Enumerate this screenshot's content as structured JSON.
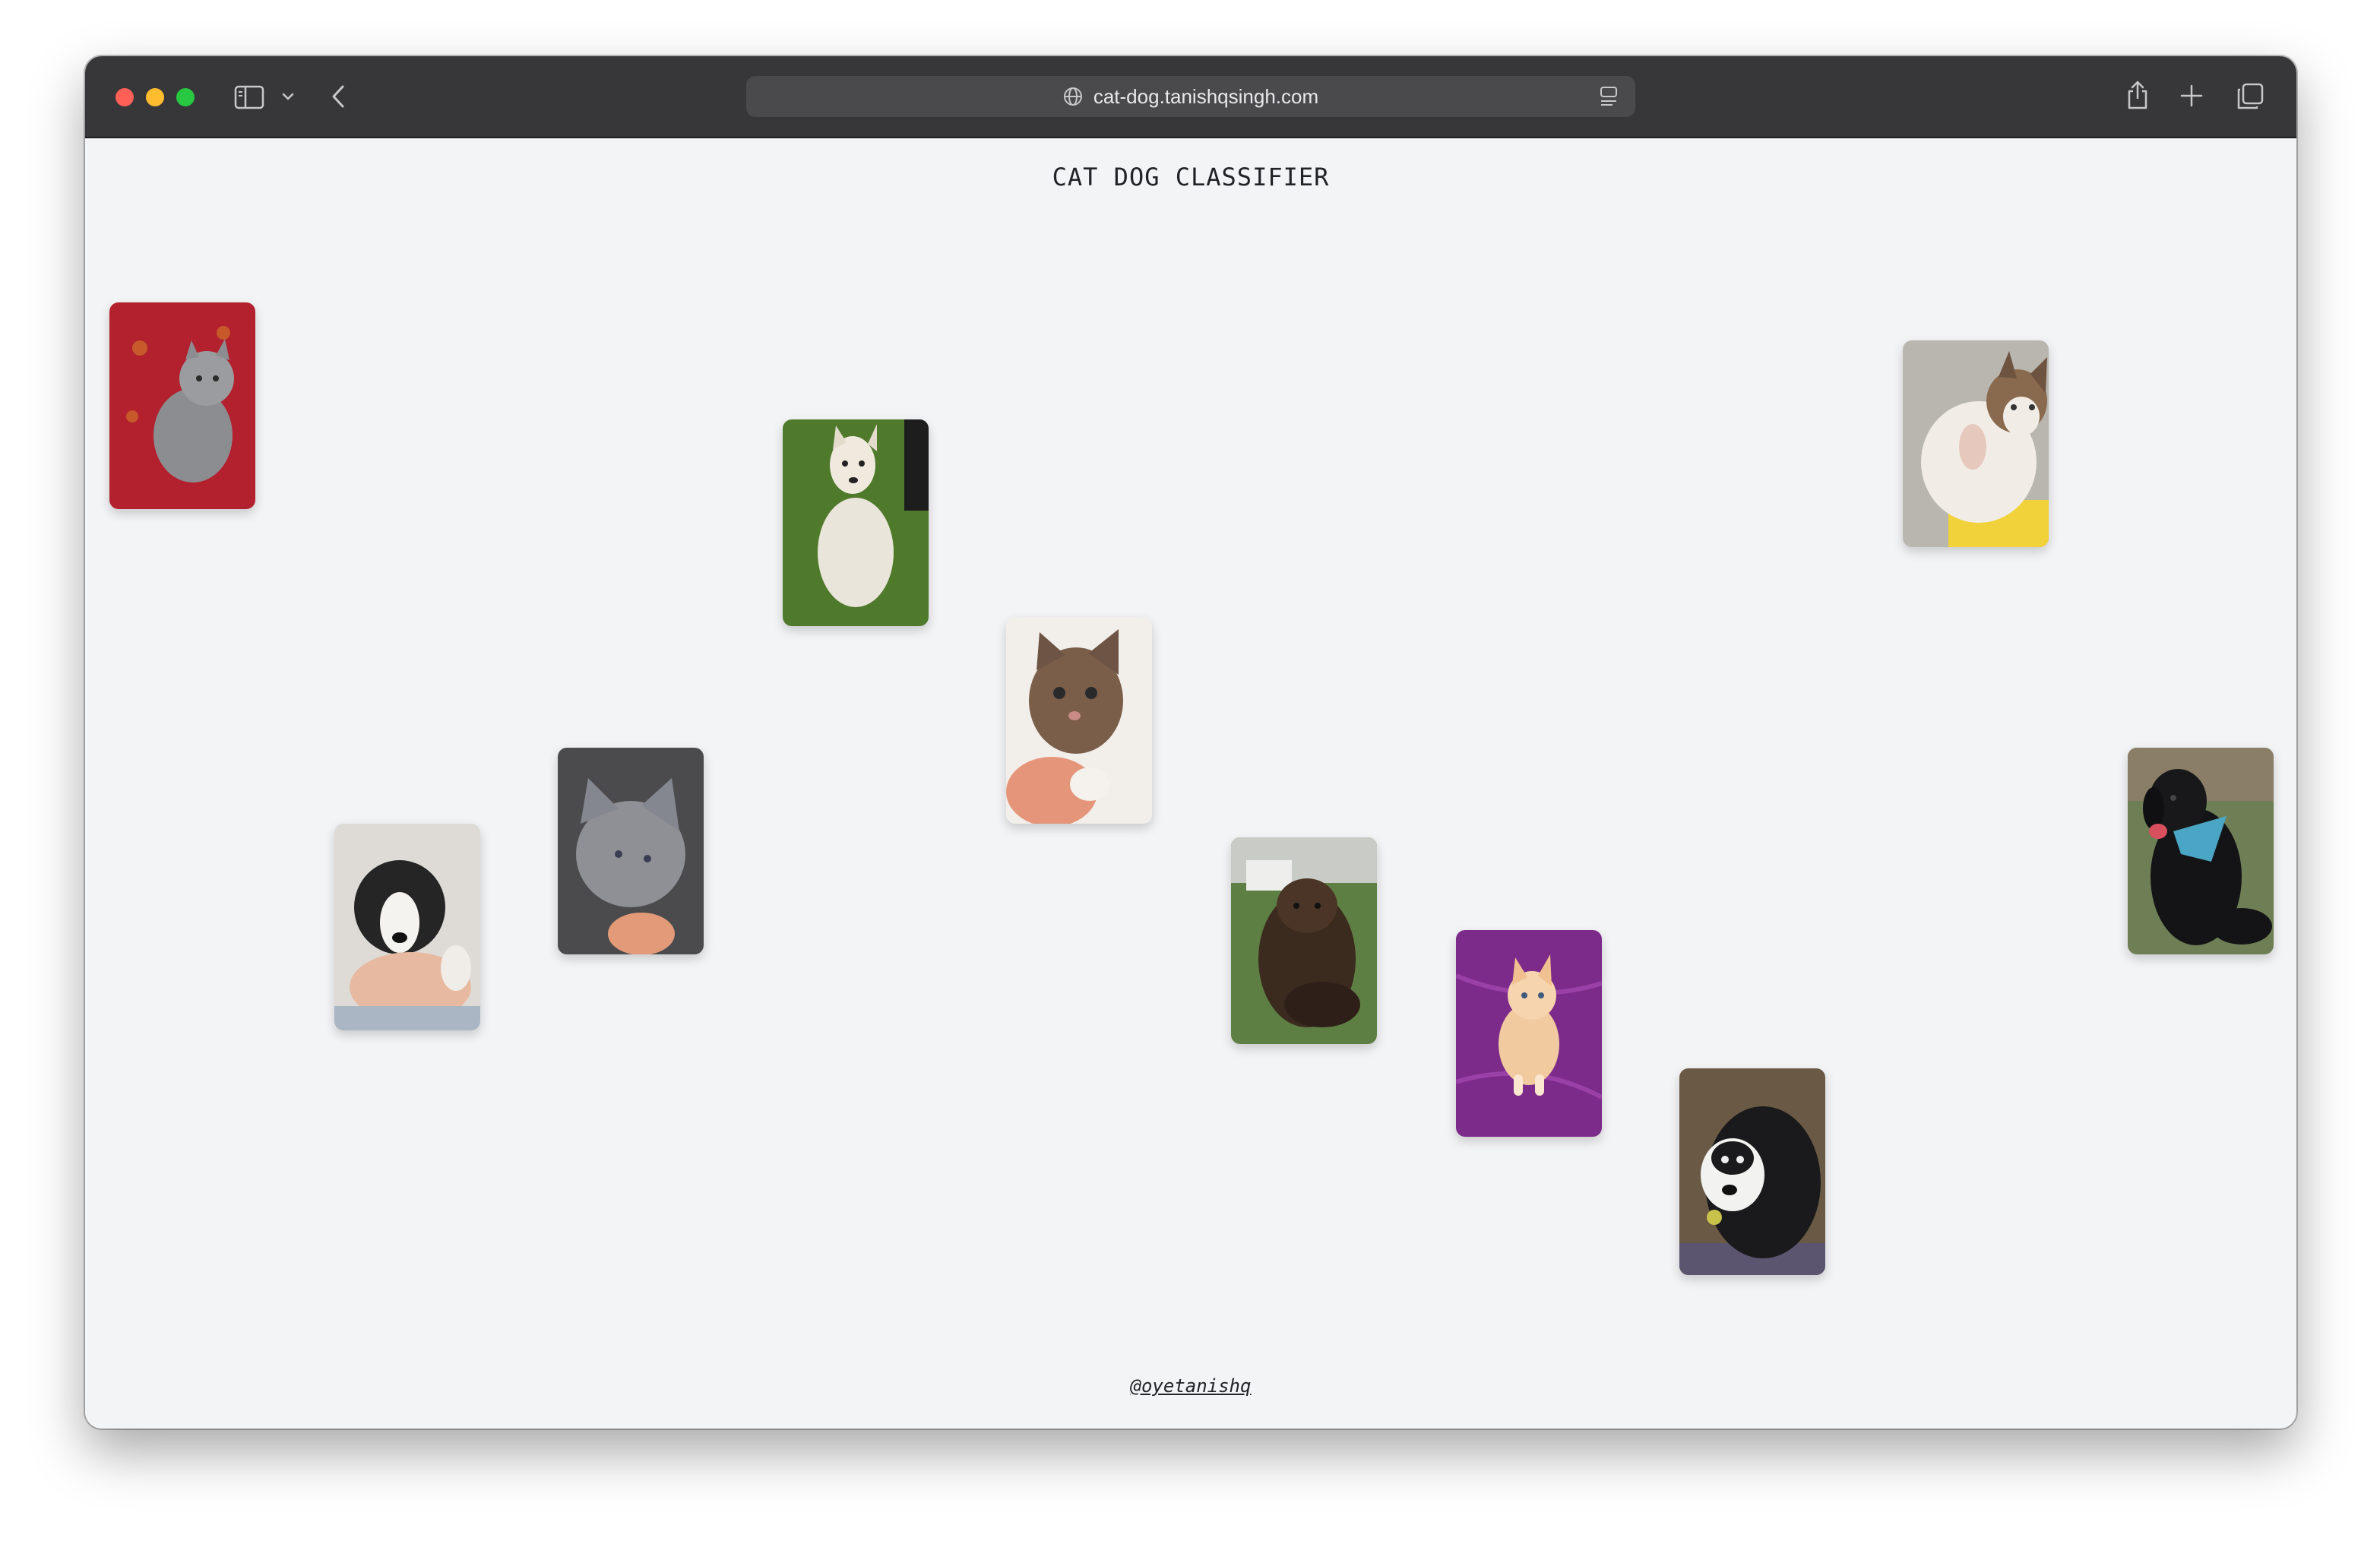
{
  "browser": {
    "url": "cat-dog.tanishqsingh.com",
    "icons": [
      "close-window",
      "minimize-window",
      "zoom-window",
      "sidebar-icon",
      "chevron-down-icon",
      "back-arrow-icon",
      "globe-icon",
      "reader-icon",
      "share-icon",
      "plus-icon",
      "tabs-icon"
    ]
  },
  "page": {
    "title": "CAT DOG CLASSIFIER",
    "footer_link": "@oyetanishq"
  },
  "cards": [
    {
      "animal": "cat",
      "colors": [
        "#b3202e",
        "#8b8d91"
      ]
    },
    {
      "animal": "dog",
      "colors": [
        "#4f7a2c",
        "#eae5da"
      ]
    },
    {
      "animal": "cat",
      "colors": [
        "#f2eee9",
        "#7a5e4a"
      ]
    },
    {
      "animal": "dog",
      "colors": [
        "#dedbd6",
        "#252526"
      ]
    },
    {
      "animal": "cat",
      "colors": [
        "#4b4b4d",
        "#8e9096"
      ]
    },
    {
      "animal": "dog",
      "colors": [
        "#5e7f43",
        "#3b2a1e"
      ]
    },
    {
      "animal": "cat",
      "colors": [
        "#7d2b8a",
        "#f2caa0"
      ]
    },
    {
      "animal": "dog",
      "colors": [
        "#6a5a45",
        "#1a1a1c"
      ]
    },
    {
      "animal": "cat",
      "colors": [
        "#b9b6b0",
        "#f2d23a"
      ]
    },
    {
      "animal": "dog",
      "colors": [
        "#6f7f55",
        "#141416"
      ]
    }
  ]
}
